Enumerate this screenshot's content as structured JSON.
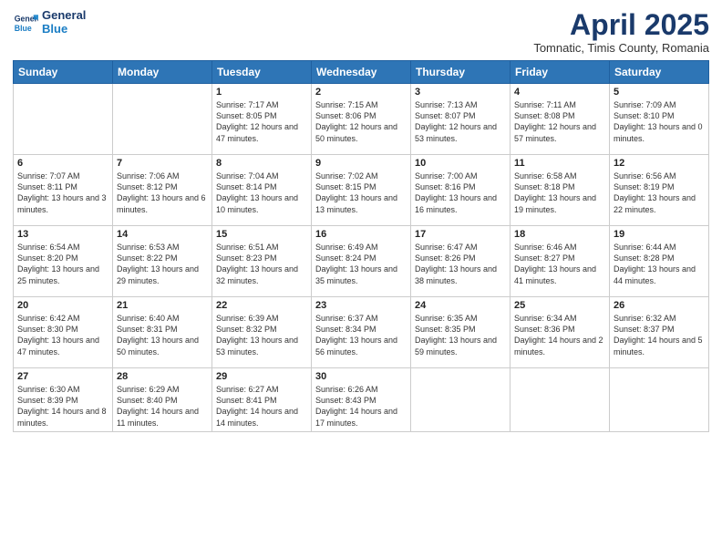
{
  "header": {
    "logo_general": "General",
    "logo_blue": "Blue",
    "month": "April 2025",
    "location": "Tomnatic, Timis County, Romania"
  },
  "weekdays": [
    "Sunday",
    "Monday",
    "Tuesday",
    "Wednesday",
    "Thursday",
    "Friday",
    "Saturday"
  ],
  "weeks": [
    [
      {
        "day": "",
        "info": ""
      },
      {
        "day": "",
        "info": ""
      },
      {
        "day": "1",
        "info": "Sunrise: 7:17 AM\nSunset: 8:05 PM\nDaylight: 12 hours and 47 minutes."
      },
      {
        "day": "2",
        "info": "Sunrise: 7:15 AM\nSunset: 8:06 PM\nDaylight: 12 hours and 50 minutes."
      },
      {
        "day": "3",
        "info": "Sunrise: 7:13 AM\nSunset: 8:07 PM\nDaylight: 12 hours and 53 minutes."
      },
      {
        "day": "4",
        "info": "Sunrise: 7:11 AM\nSunset: 8:08 PM\nDaylight: 12 hours and 57 minutes."
      },
      {
        "day": "5",
        "info": "Sunrise: 7:09 AM\nSunset: 8:10 PM\nDaylight: 13 hours and 0 minutes."
      }
    ],
    [
      {
        "day": "6",
        "info": "Sunrise: 7:07 AM\nSunset: 8:11 PM\nDaylight: 13 hours and 3 minutes."
      },
      {
        "day": "7",
        "info": "Sunrise: 7:06 AM\nSunset: 8:12 PM\nDaylight: 13 hours and 6 minutes."
      },
      {
        "day": "8",
        "info": "Sunrise: 7:04 AM\nSunset: 8:14 PM\nDaylight: 13 hours and 10 minutes."
      },
      {
        "day": "9",
        "info": "Sunrise: 7:02 AM\nSunset: 8:15 PM\nDaylight: 13 hours and 13 minutes."
      },
      {
        "day": "10",
        "info": "Sunrise: 7:00 AM\nSunset: 8:16 PM\nDaylight: 13 hours and 16 minutes."
      },
      {
        "day": "11",
        "info": "Sunrise: 6:58 AM\nSunset: 8:18 PM\nDaylight: 13 hours and 19 minutes."
      },
      {
        "day": "12",
        "info": "Sunrise: 6:56 AM\nSunset: 8:19 PM\nDaylight: 13 hours and 22 minutes."
      }
    ],
    [
      {
        "day": "13",
        "info": "Sunrise: 6:54 AM\nSunset: 8:20 PM\nDaylight: 13 hours and 25 minutes."
      },
      {
        "day": "14",
        "info": "Sunrise: 6:53 AM\nSunset: 8:22 PM\nDaylight: 13 hours and 29 minutes."
      },
      {
        "day": "15",
        "info": "Sunrise: 6:51 AM\nSunset: 8:23 PM\nDaylight: 13 hours and 32 minutes."
      },
      {
        "day": "16",
        "info": "Sunrise: 6:49 AM\nSunset: 8:24 PM\nDaylight: 13 hours and 35 minutes."
      },
      {
        "day": "17",
        "info": "Sunrise: 6:47 AM\nSunset: 8:26 PM\nDaylight: 13 hours and 38 minutes."
      },
      {
        "day": "18",
        "info": "Sunrise: 6:46 AM\nSunset: 8:27 PM\nDaylight: 13 hours and 41 minutes."
      },
      {
        "day": "19",
        "info": "Sunrise: 6:44 AM\nSunset: 8:28 PM\nDaylight: 13 hours and 44 minutes."
      }
    ],
    [
      {
        "day": "20",
        "info": "Sunrise: 6:42 AM\nSunset: 8:30 PM\nDaylight: 13 hours and 47 minutes."
      },
      {
        "day": "21",
        "info": "Sunrise: 6:40 AM\nSunset: 8:31 PM\nDaylight: 13 hours and 50 minutes."
      },
      {
        "day": "22",
        "info": "Sunrise: 6:39 AM\nSunset: 8:32 PM\nDaylight: 13 hours and 53 minutes."
      },
      {
        "day": "23",
        "info": "Sunrise: 6:37 AM\nSunset: 8:34 PM\nDaylight: 13 hours and 56 minutes."
      },
      {
        "day": "24",
        "info": "Sunrise: 6:35 AM\nSunset: 8:35 PM\nDaylight: 13 hours and 59 minutes."
      },
      {
        "day": "25",
        "info": "Sunrise: 6:34 AM\nSunset: 8:36 PM\nDaylight: 14 hours and 2 minutes."
      },
      {
        "day": "26",
        "info": "Sunrise: 6:32 AM\nSunset: 8:37 PM\nDaylight: 14 hours and 5 minutes."
      }
    ],
    [
      {
        "day": "27",
        "info": "Sunrise: 6:30 AM\nSunset: 8:39 PM\nDaylight: 14 hours and 8 minutes."
      },
      {
        "day": "28",
        "info": "Sunrise: 6:29 AM\nSunset: 8:40 PM\nDaylight: 14 hours and 11 minutes."
      },
      {
        "day": "29",
        "info": "Sunrise: 6:27 AM\nSunset: 8:41 PM\nDaylight: 14 hours and 14 minutes."
      },
      {
        "day": "30",
        "info": "Sunrise: 6:26 AM\nSunset: 8:43 PM\nDaylight: 14 hours and 17 minutes."
      },
      {
        "day": "",
        "info": ""
      },
      {
        "day": "",
        "info": ""
      },
      {
        "day": "",
        "info": ""
      }
    ]
  ]
}
